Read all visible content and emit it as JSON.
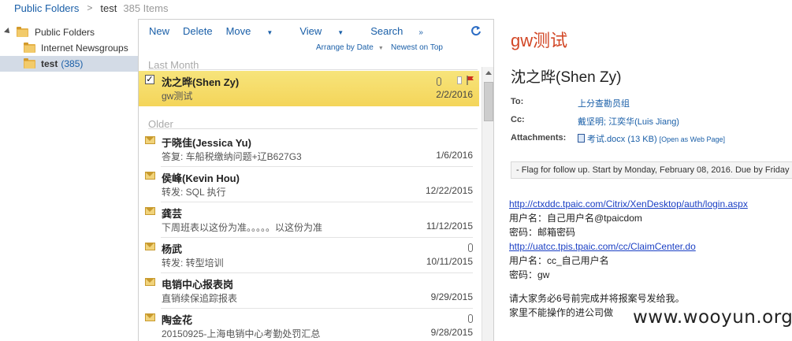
{
  "breadcrumb": {
    "root": "Public Folders",
    "separator": ">",
    "current": "test",
    "count": "385 Items"
  },
  "folders": [
    {
      "label": "Public Folders",
      "expanded": true
    },
    {
      "label": "Internet Newsgroups"
    },
    {
      "label": "test",
      "count": "(385)",
      "selected": true
    }
  ],
  "toolbar": {
    "new": "New",
    "delete": "Delete",
    "move": "Move",
    "view": "View",
    "search": "Search"
  },
  "sort": {
    "arrange": "Arrange by Date",
    "order": "Newest on Top"
  },
  "groups": {
    "last_month": "Last Month",
    "older": "Older"
  },
  "messages": [
    {
      "sender": "沈之晔(Shen Zy)",
      "subject": "gw测试",
      "date": "2/2/2016"
    },
    {
      "sender": "于晓佳(Jessica Yu)",
      "subject": "答复: 车船税缴纳问题+辽B627G3",
      "date": "1/6/2016"
    },
    {
      "sender": "侯峰(Kevin Hou)",
      "subject": "转发: SQL 执行",
      "date": "12/22/2015"
    },
    {
      "sender": "龚芸",
      "subject": "下周班表以这份为准。。。。。以这份为准",
      "date": "11/12/2015"
    },
    {
      "sender": "杨武",
      "subject": "转发: 转型培训",
      "date": "10/11/2015"
    },
    {
      "sender": "电销中心报表岗",
      "subject": "直销续保追踪报表",
      "date": "9/29/2015"
    },
    {
      "sender": "陶金花",
      "subject": "20150925-上海电销中心考勤处罚汇总",
      "date": "9/28/2015"
    }
  ],
  "reader": {
    "title": "gw测试",
    "sender": "沈之晔(Shen Zy)",
    "to_label": "To:",
    "to": "上分查勘员组",
    "cc_label": "Cc:",
    "cc": "戴坚明; 江奕华(Luis Jiang)",
    "attachments_label": "Attachments:",
    "attachment": "考试.docx (13 KB)",
    "attachment_web": "[Open as Web Page]",
    "flag_text": "- Flag for follow up. Start by Monday, February 08, 2016. Due by Friday",
    "body_link1": "http://ctxddc.tpaic.com/Citrix/XenDesktop/auth/login.aspx",
    "body_user1": "用户名：自己用户名@tpaicdom",
    "body_pwd1": "密码：邮箱密码",
    "body_link2": "http://uatcc.tpis.tpaic.com/cc/ClaimCenter.do",
    "body_user2": "用户名：cc_自己用户名",
    "body_pwd2": "密码：gw",
    "body_line1": "请大家务必6号前完成并将报案号发给我。",
    "body_line2": "家里不能操作的进公司做"
  },
  "watermark": "www.wooyun.org",
  "colors": {
    "accent": "#d24726",
    "link": "#1a5fa8",
    "selected_row": "#f5da63"
  }
}
